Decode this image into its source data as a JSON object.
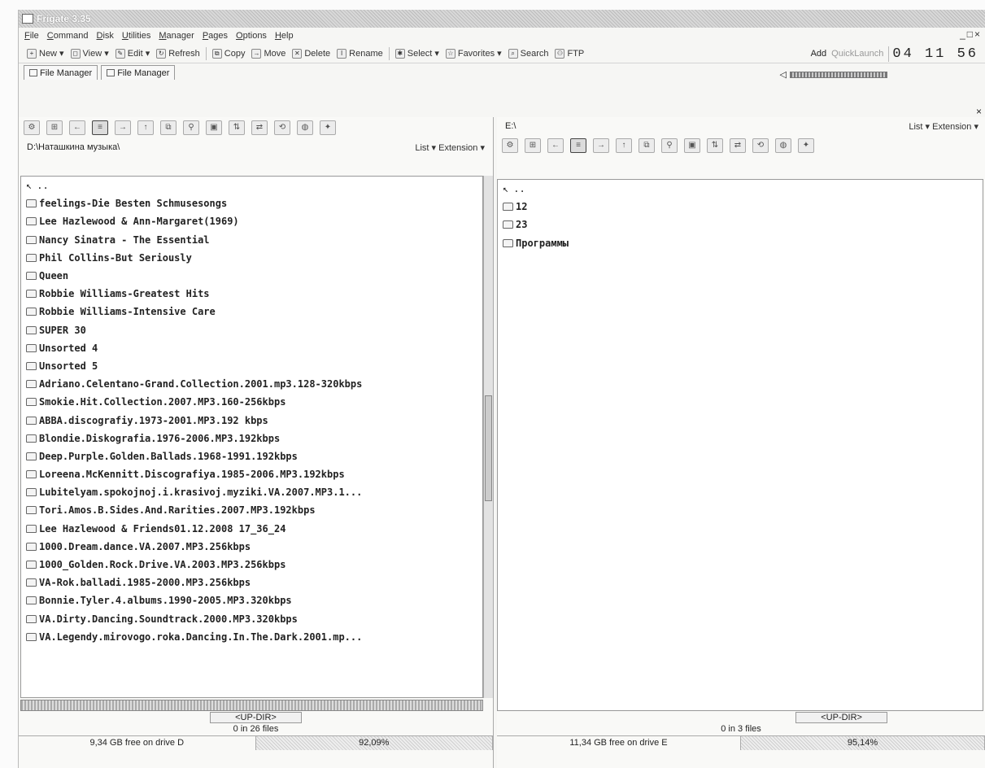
{
  "window": {
    "title": "Frigate 3.35"
  },
  "menu": [
    "File",
    "Command",
    "Disk",
    "Utilities",
    "Manager",
    "Pages",
    "Options",
    "Help"
  ],
  "toolbar": {
    "buttons": [
      "New",
      "View",
      "Edit",
      "Refresh",
      "Copy",
      "Move",
      "Delete",
      "Rename",
      "Select",
      "Favorites",
      "Search",
      "FTP"
    ],
    "add_label": "Add",
    "quick_launch_label": "QuickLaunch",
    "clock": "04 11 56"
  },
  "tabs": [
    "File Manager",
    "File Manager"
  ],
  "left_pane": {
    "path": "D:\\Наташкина музыка\\",
    "view_mode": "List",
    "sort_mode": "Extension",
    "updir_row": "..",
    "files": [
      "feelings-Die Besten Schmusesongs",
      "Lee Hazlewood & Ann-Margaret(1969)",
      "Nancy Sinatra - The Essential",
      "Phil Collins-But Seriously",
      "Queen",
      "Robbie Williams-Greatest Hits",
      "Robbie Williams-Intensive Care",
      "SUPER 30",
      "Unsorted 4",
      "Unsorted 5",
      "Adriano.Celentano-Grand.Collection.2001.mp3.128-320kbps",
      "Smokie.Hit.Collection.2007.MP3.160-256kbps",
      "ABBA.discografiy.1973-2001.MP3.192 kbps",
      "Blondie.Diskografia.1976-2006.MP3.192kbps",
      "Deep.Purple.Golden.Ballads.1968-1991.192kbps",
      "Loreena.McKennitt.Discografiya.1985-2006.MP3.192kbps",
      "Lubitelyam.spokojnoj.i.krasivoj.myziki.VA.2007.MP3.1...",
      "Tori.Amos.B.Sides.And.Rarities.2007.MP3.192kbps",
      "Lee Hazlewood & Friends01.12.2008 17_36_24",
      "1000.Dream.dance.VA.2007.MP3.256kbps",
      "1000_Golden.Rock.Drive.VA.2003.MP3.256kbps",
      "VA-Rok.balladi.1985-2000.MP3.256kbps",
      "Bonnie.Tyler.4.albums.1990-2005.MP3.320kbps",
      "VA.Dirty.Dancing.Soundtrack.2000.MP3.320kbps",
      "VA.Legendy.mirovogo.roka.Dancing.In.The.Dark.2001.mp..."
    ],
    "updir_label": "<UP-DIR>",
    "count": "0 in 26 files",
    "free": "9,34 GB free on drive D",
    "percent": "92,09%"
  },
  "right_pane": {
    "path": "E:\\",
    "view_mode": "List",
    "sort_mode": "Extension",
    "updir_row": "..",
    "files": [
      "12",
      "23",
      "Программы"
    ],
    "updir_label": "<UP-DIR>",
    "count": "0 in 3 files",
    "free": "11,34 GB free on drive E",
    "percent": "95,14%"
  }
}
